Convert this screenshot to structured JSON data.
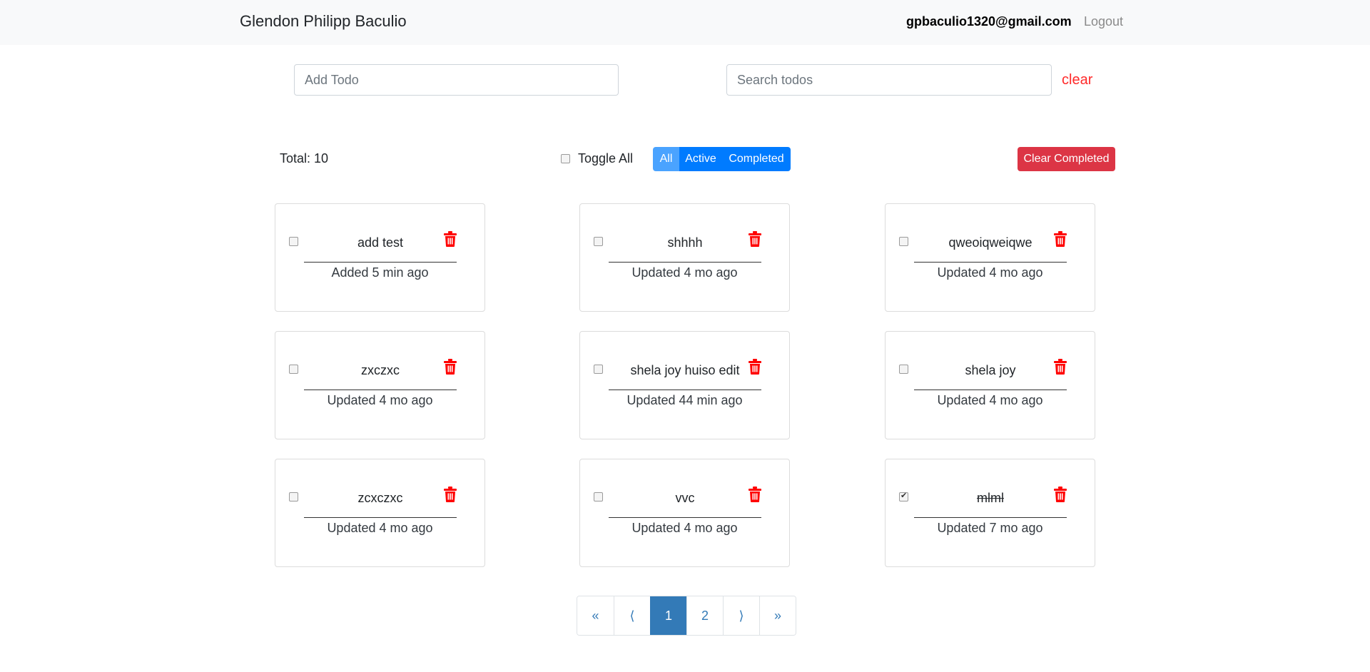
{
  "navbar": {
    "brand": "Glendon Philipp Baculio",
    "email": "gpbaculio1320@gmail.com",
    "logout_label": "Logout"
  },
  "add_todo": {
    "placeholder": "Add Todo",
    "value": ""
  },
  "search": {
    "placeholder": "Search todos",
    "value": "",
    "clear_label": "clear"
  },
  "toolbar": {
    "total_label": "Total: 10",
    "toggle_all_label": "Toggle All",
    "toggle_all_checked": false,
    "filters": [
      {
        "label": "All",
        "active": true
      },
      {
        "label": "Active",
        "active": false
      },
      {
        "label": "Completed",
        "active": false
      }
    ],
    "clear_completed_label": "Clear Completed"
  },
  "todos": [
    {
      "title": "add test",
      "meta": "Added 5 min ago",
      "completed": false
    },
    {
      "title": "shhhh",
      "meta": "Updated 4 mo ago",
      "completed": false
    },
    {
      "title": "qweoiqweiqwe",
      "meta": "Updated 4 mo ago",
      "completed": false
    },
    {
      "title": "zxczxc",
      "meta": "Updated 4 mo ago",
      "completed": false
    },
    {
      "title": "shela joy huiso edit",
      "meta": "Updated 44 min ago",
      "completed": false
    },
    {
      "title": "shela joy",
      "meta": "Updated 4 mo ago",
      "completed": false
    },
    {
      "title": "zcxczxc",
      "meta": "Updated 4 mo ago",
      "completed": false
    },
    {
      "title": "vvc",
      "meta": "Updated 4 mo ago",
      "completed": false
    },
    {
      "title": "mlml",
      "meta": "Updated 7 mo ago",
      "completed": true
    }
  ],
  "pagination": {
    "first": "«",
    "prev": "⟨",
    "pages": [
      "1",
      "2"
    ],
    "current": "1",
    "next": "⟩",
    "last": "»"
  },
  "colors": {
    "trash": "#ff0000",
    "primary": "#007bff",
    "danger": "#dc3545",
    "pagination_active": "#337ab7"
  }
}
